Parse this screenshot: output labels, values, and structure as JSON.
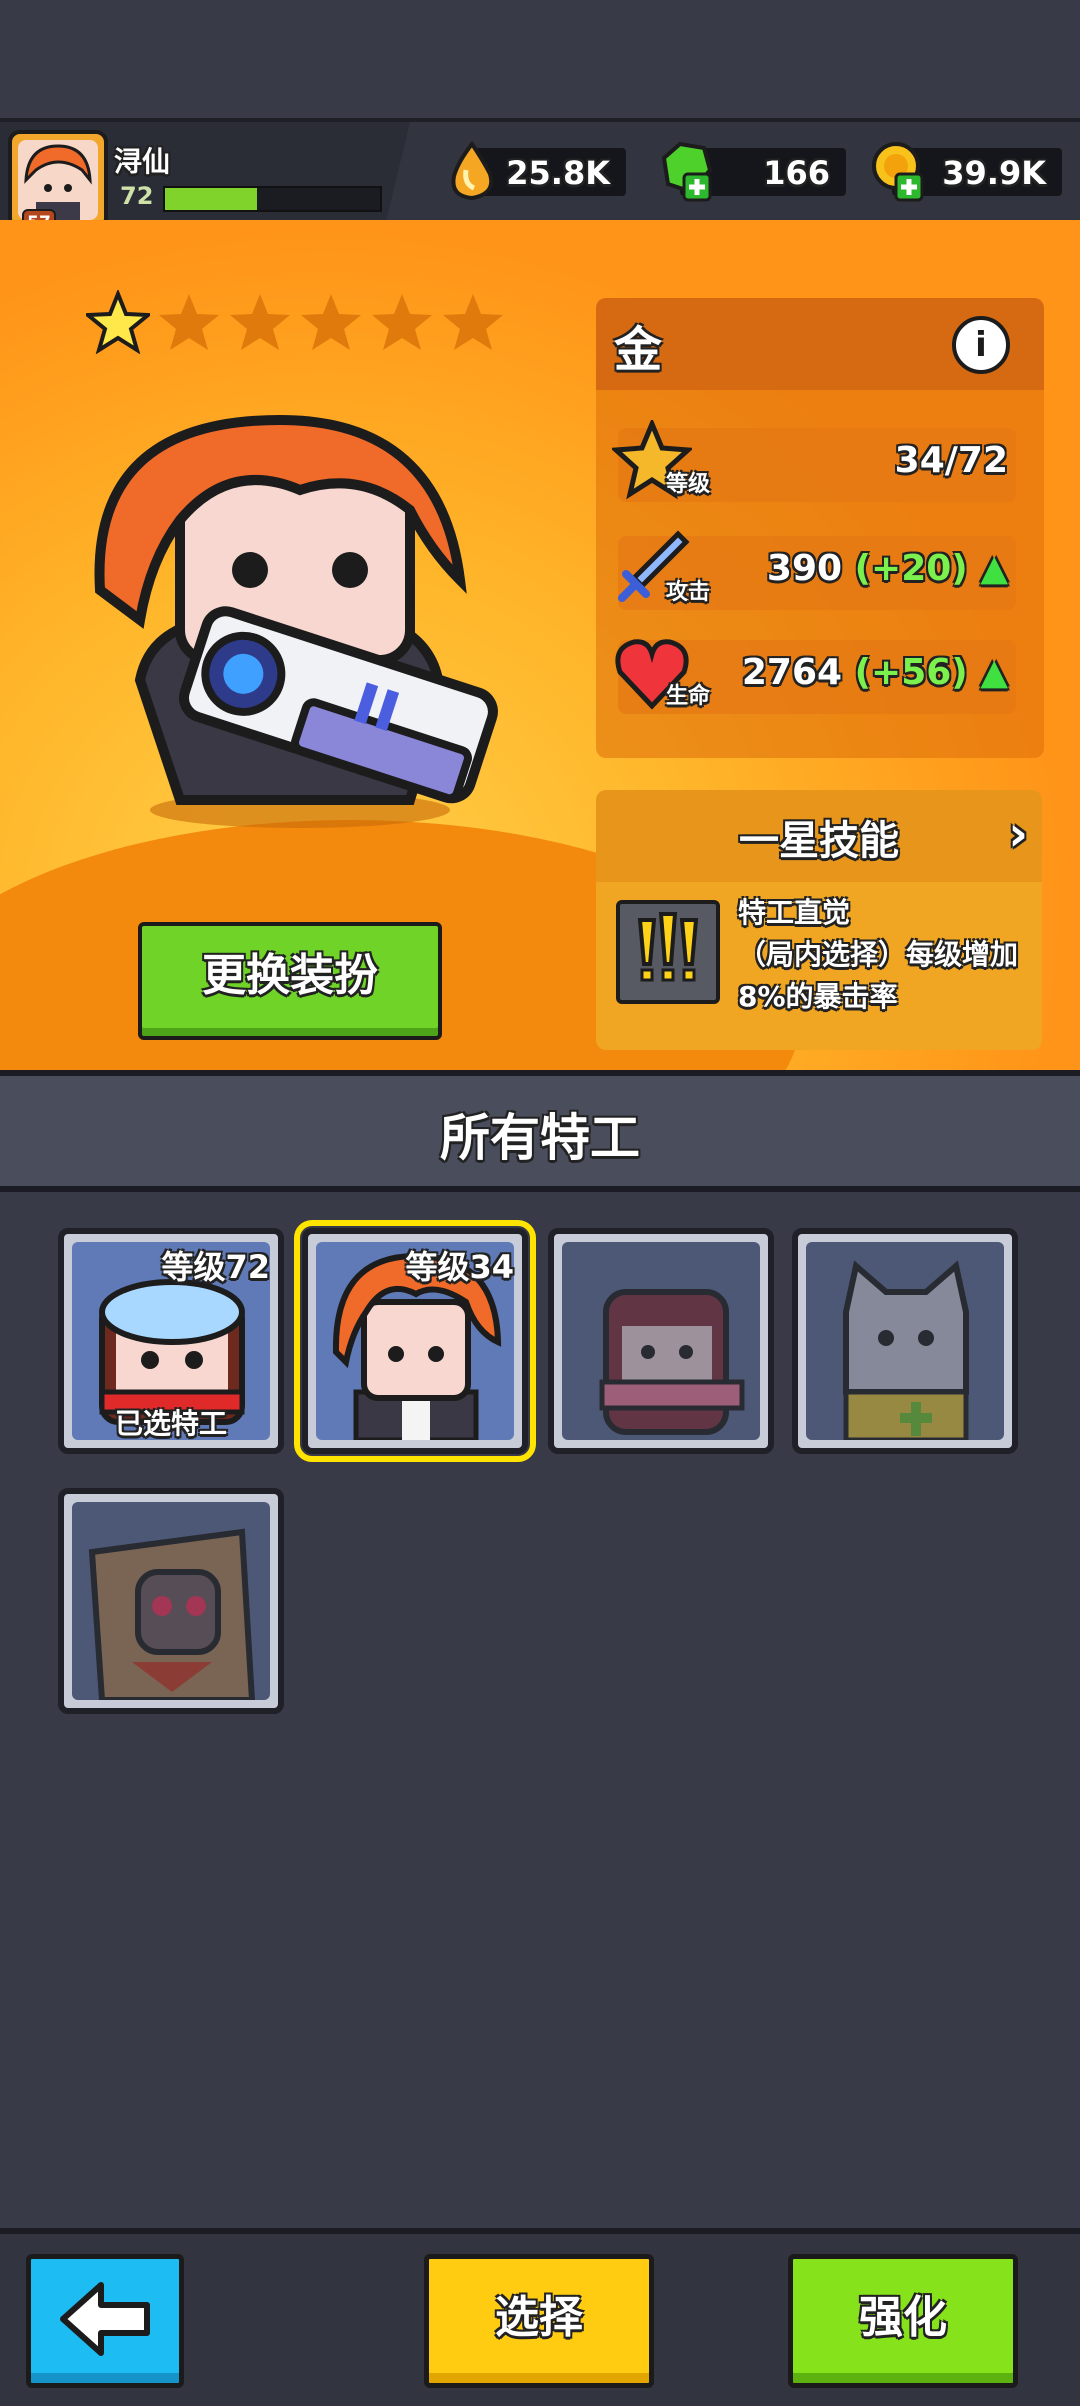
{
  "player": {
    "name": "浔仙",
    "avatar_level": "57",
    "level": "72",
    "xp_fraction": 0.43
  },
  "resources": [
    {
      "name": "energy",
      "icon": "flame-drop-icon",
      "value": "25.8K",
      "color": "#f5a623"
    },
    {
      "name": "gems",
      "icon": "green-gem-plus-icon",
      "value": "166",
      "color": "#4fd12c"
    },
    {
      "name": "gold",
      "icon": "gold-coin-plus-icon",
      "value": "39.9K",
      "color": "#f8c21b"
    }
  ],
  "hero": {
    "stars_total": 6,
    "stars_filled": 1,
    "name": "金",
    "stats": [
      {
        "key": "level",
        "icon": "level-star-badge-icon",
        "label": "等级",
        "value": "34/72",
        "bonus": ""
      },
      {
        "key": "attack",
        "icon": "sword-icon",
        "label": "攻击",
        "value": "390",
        "bonus": "(+20)"
      },
      {
        "key": "hp",
        "icon": "heart-icon",
        "label": "生命",
        "value": "2764",
        "bonus": "(+56)"
      }
    ],
    "skill_title": "一星技能",
    "skill_text": "特工直觉\n（局内选择）每级增加8%的暴击率",
    "change_outfit": "更换装扮"
  },
  "section_title": "所有特工",
  "agents": [
    {
      "name": "goggles-agent",
      "level_label": "等级72",
      "tag": "已选特工",
      "locked": false,
      "selected": false
    },
    {
      "name": "jin-agent",
      "level_label": "等级34",
      "tag": "",
      "locked": false,
      "selected": true
    },
    {
      "name": "scarf-agent",
      "level_label": "",
      "tag": "",
      "locked": true,
      "selected": false
    },
    {
      "name": "cat-agent",
      "level_label": "",
      "tag": "",
      "locked": true,
      "selected": false
    },
    {
      "name": "masked-agent",
      "level_label": "",
      "tag": "",
      "locked": true,
      "selected": false
    }
  ],
  "buttons": {
    "back_icon": "back-arrow-icon",
    "select": "选择",
    "upgrade": "强化"
  },
  "colors": {
    "accent_green": "#6fd328",
    "select_yellow": "#ffcc12",
    "back_blue": "#1dbcf2",
    "highlight": "#ffe400"
  }
}
